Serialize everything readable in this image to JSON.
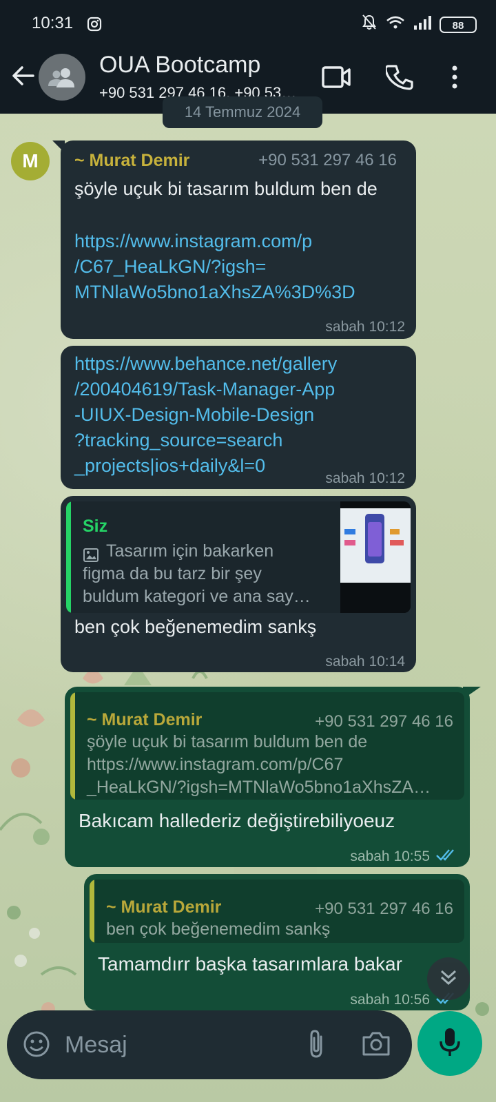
{
  "status_bar": {
    "time": "10:31",
    "battery": "88",
    "icons": [
      "instagram-icon",
      "bell-off-icon",
      "wifi-icon",
      "signal-icon",
      "battery-icon"
    ]
  },
  "app_bar": {
    "title": "OUA Bootcamp",
    "subtitle": "+90 531 297 46 16, +90 53…",
    "icons": [
      "back-arrow-icon",
      "group-avatar-icon",
      "video-call-icon",
      "voice-call-icon",
      "more-vert-icon"
    ]
  },
  "date_chip": "14 Temmuz 2024",
  "messages": [
    {
      "direction": "in",
      "avatar": "M",
      "sender": "~ Murat Demir",
      "phone": "+90 531 297 46 16",
      "text": "şöyle uçuk bi tasarım buldum ben de",
      "link_lines": [
        "https://www.instagram.com/p",
        "/C67_HeaLkGN/?igsh=",
        "MTNlaWo5bno1aXhsZA%3D%3D"
      ],
      "time": "sabah 10:12"
    },
    {
      "direction": "in",
      "link_lines": [
        "https://www.behance.net/gallery",
        "/200404619/Task-Manager-App",
        "-UIUX-Design-Mobile-Design",
        "?tracking_source=search",
        "_projects|ios+daily&l=0"
      ],
      "time": "sabah 10:12"
    },
    {
      "direction": "in",
      "quote": {
        "sender": "Siz",
        "lines": [
          "Tasarım için bakarken",
          "figma da bu tarz bir şey",
          "buldum kategori ve ana say…"
        ],
        "has_image": true
      },
      "text": "ben çok beğenemedim sankş",
      "time": "sabah 10:14"
    },
    {
      "direction": "out",
      "quote": {
        "sender": "~ Murat Demir",
        "phone": "+90 531 297 46 16",
        "lines": [
          "şöyle uçuk bi tasarım buldum ben de",
          "https://www.instagram.com/p/C67",
          "_HeaLkGN/?igsh=MTNlaWo5bno1aXhsZA…"
        ]
      },
      "text": "Bakıcam hallederiz değiştirebiliyoeuz",
      "time": "sabah 10:55",
      "read": true
    },
    {
      "direction": "out",
      "quote": {
        "sender": "~ Murat Demir",
        "phone": "+90 531 297 46 16",
        "lines": [
          "ben çok beğenemedim sankş"
        ]
      },
      "text": "Tamamdırr başka tasarımlara bakar",
      "time": "sabah 10:56",
      "read": true
    }
  ],
  "composer": {
    "placeholder": "Mesaj",
    "icons": [
      "emoji-icon",
      "attach-icon",
      "camera-icon",
      "mic-icon"
    ]
  },
  "colors": {
    "header_bg": "#121b22",
    "bubble_in": "#202c33",
    "bubble_out": "#134d37",
    "link": "#53bdeb",
    "sender": "#c7b23c",
    "self_sender": "#25d366",
    "mic_bg": "#00a884"
  }
}
